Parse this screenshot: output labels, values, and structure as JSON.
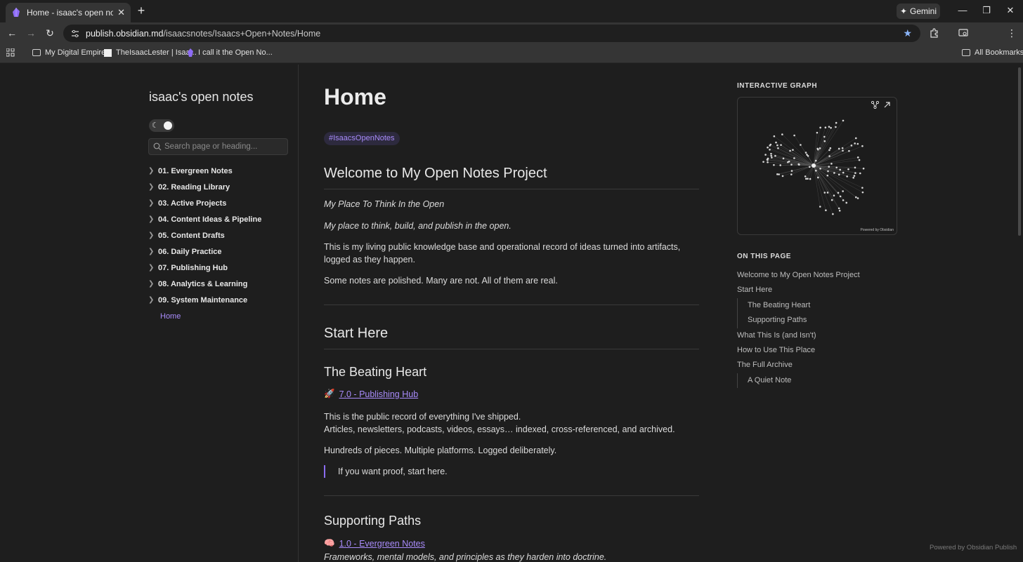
{
  "browser": {
    "tab_title": "Home - isaac's open notes - Obsidian Publish",
    "new_tab": "+",
    "gemini_label": "Gemini",
    "url_host": "publish.obsidian.md",
    "url_path": "/isaacsnotes/Isaacs+Open+Notes/Home",
    "bookmarks": [
      "My Digital Empire",
      "TheIsaacLester | Isaa...",
      "I call it the Open No..."
    ],
    "all_bookmarks": "All Bookmarks",
    "accent": "#8ab4f8"
  },
  "sidebar": {
    "site_name": "isaac's open notes",
    "search_placeholder": "Search page or heading...",
    "items": [
      "01. Evergreen Notes",
      "02. Reading Library",
      "03. Active Projects",
      "04. Content Ideas & Pipeline",
      "05. Content Drafts",
      "06. Daily Practice",
      "07. Publishing Hub",
      "08. Analytics & Learning",
      "09. System Maintenance"
    ],
    "home": "Home"
  },
  "main": {
    "title": "Home",
    "tag": "#IsaacsOpenNotes",
    "welcome_heading": "Welcome to My Open Notes Project",
    "tagline_1": "My Place To Think In the Open",
    "tagline_2": "My place to think, build, and publish in the open.",
    "intro": "This is my living public knowledge base and operational record of ideas turned into artifacts, logged as they happen.",
    "polished": "Some notes are polished. Many are not. All of them are real.",
    "start_heading": "Start Here",
    "beating_heading": "The Beating Heart",
    "publishing_emoji": "🚀",
    "publishing_link": "7.0 - Publishing Hub",
    "record_line1": "This is the public record of everything I've shipped.",
    "record_line2": "Articles, newsletters, podcasts, videos, essays… indexed, cross-referenced, and archived.",
    "hundreds": "Hundreds of pieces. Multiple platforms. Logged deliberately.",
    "quote": "If you want proof, start here.",
    "supporting_heading": "Supporting Paths",
    "evergreen_emoji": "🧠",
    "evergreen_link": "1.0 - Evergreen Notes",
    "frameworks": "Frameworks, mental models, and principles as they harden into doctrine."
  },
  "right": {
    "graph_title": "INTERACTIVE GRAPH",
    "graph_powered": "Powered by Obsidian",
    "toc_title": "ON THIS PAGE",
    "toc": [
      {
        "label": "Welcome to My Open Notes Project",
        "sub": false
      },
      {
        "label": "Start Here",
        "sub": false
      },
      {
        "label": "The Beating Heart",
        "sub": true
      },
      {
        "label": "Supporting Paths",
        "sub": true
      },
      {
        "label": "What This Is (and Isn't)",
        "sub": false
      },
      {
        "label": "How to Use This Place",
        "sub": false
      },
      {
        "label": "The Full Archive",
        "sub": false
      },
      {
        "label": "A Quiet Note",
        "sub": true
      }
    ]
  },
  "footer": "Powered by Obsidian Publish",
  "colors": {
    "accent": "#a88bfa",
    "background": "#1e1e1e"
  }
}
